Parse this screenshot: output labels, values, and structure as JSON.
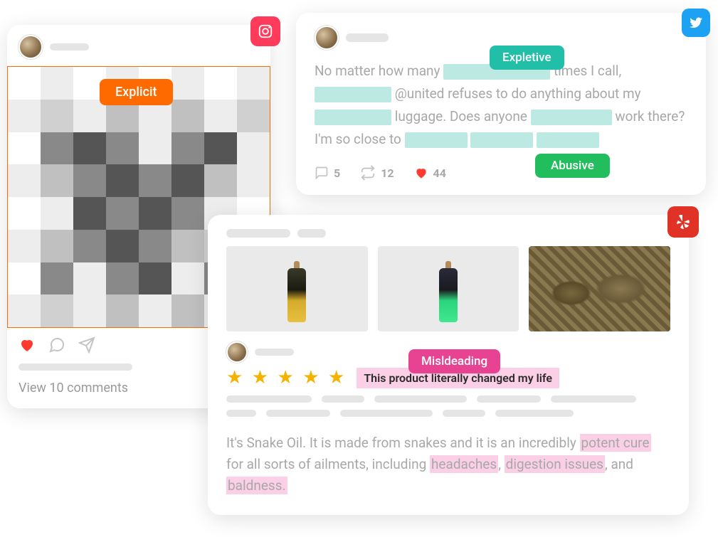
{
  "instagram": {
    "explicit_label": "Explicit",
    "comments_label": "View 10 comments",
    "pixelation": [
      "#fff",
      "#ededed",
      "#fff",
      "#ededed",
      "#fff",
      "#ededed",
      "#fff",
      "#ededed",
      "#ededed",
      "#d0d0d0",
      "#ededed",
      "#c0c0c0",
      "#ededed",
      "#c0c0c0",
      "#ededed",
      "#d0d0d0",
      "#fff",
      "#898989",
      "#555",
      "#898989",
      "#ededed",
      "#898989",
      "#555",
      "#ededed",
      "#ededed",
      "#c0c0c0",
      "#898989",
      "#555",
      "#898989",
      "#555",
      "#c0c0c0",
      "#ededed",
      "#fff",
      "#ededed",
      "#555",
      "#898989",
      "#555",
      "#898989",
      "#ededed",
      "#fff",
      "#ededed",
      "#c0c0c0",
      "#898989",
      "#555",
      "#898989",
      "#c0c0c0",
      "#d0d0d0",
      "#ededed",
      "#fff",
      "#898989",
      "#ededed",
      "#898989",
      "#555",
      "#ededed",
      "#898989",
      "#fff",
      "#ededed",
      "#d0d0d0",
      "#ededed",
      "#c0c0c0",
      "#ededed",
      "#c0c0c0",
      "#ededed",
      "#d0d0d0"
    ]
  },
  "twitter": {
    "expletive_label": "Expletive",
    "abusive_label": "Abusive",
    "text_parts": {
      "p1": "No matter how many ",
      "p2": " times I call, ",
      "p3": " @united refuses to do anything about my ",
      "p4": " luggage. Does anyone ",
      "p5": " work there? I'm so close to "
    },
    "replies": "5",
    "retweets": "12",
    "likes": "44"
  },
  "yelp": {
    "misleading_label": "Misldeading",
    "review_title": "This product literally changed my life",
    "stars": 5,
    "body": {
      "t1": "It's Snake Oil. It is made from snakes and it is an incredibly ",
      "h1": "potent cure",
      "t2": " for all sorts of ailments, including ",
      "h2": "headaches",
      "t3": ", ",
      "h3": "digestion issues",
      "t4": ", and ",
      "h4": "baldness.",
      "t5": ""
    }
  }
}
